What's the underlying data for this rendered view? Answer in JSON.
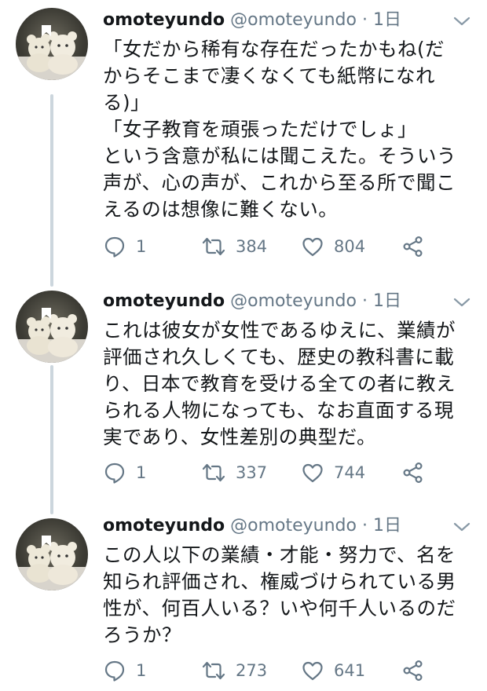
{
  "tweets": [
    {
      "name": "omoteyundo",
      "handle": "@omoteyundo",
      "separator": "·",
      "time": "1日",
      "lines": [
        "「女だから稀有な存在だったかもね(だ",
        "からそこまで凄くなくても紙幣になれ",
        "る)」",
        "「女子教育を頑張っただけでしょ」",
        "という含意が私には聞こえた。そういう",
        "声が、心の声が、これから至る所で聞こ",
        "えるのは想像に難くない。"
      ],
      "reply_count": "1",
      "retweet_count": "384",
      "like_count": "804",
      "icons": [
        "reply-icon",
        "retweet-icon",
        "like-icon",
        "share-icon",
        "chevron-down-icon"
      ]
    },
    {
      "name": "omoteyundo",
      "handle": "@omoteyundo",
      "separator": "·",
      "time": "1日",
      "lines": [
        "これは彼女が女性であるゆえに、業績が",
        "評価され久しくても、歴史の教科書に載",
        "り、日本で教育を受ける全ての者に教え",
        "られる人物になっても、なお直面する現",
        "実であり、女性差別の典型だ。"
      ],
      "reply_count": "1",
      "retweet_count": "337",
      "like_count": "744"
    },
    {
      "name": "omoteyundo",
      "handle": "@omoteyundo",
      "separator": "·",
      "time": "1日",
      "lines": [
        "この人以下の業績・才能・努力で、名を",
        "知られ評価され、権威づけられている男",
        "性が、何百人いる？いや何千人いるのだ",
        "ろうか？"
      ],
      "reply_count": "1",
      "retweet_count": "273",
      "like_count": "641"
    }
  ],
  "colors": {
    "text": "#14171a",
    "secondary": "#657786",
    "thread_line": "#ccd6dd",
    "background": "#ffffff"
  }
}
